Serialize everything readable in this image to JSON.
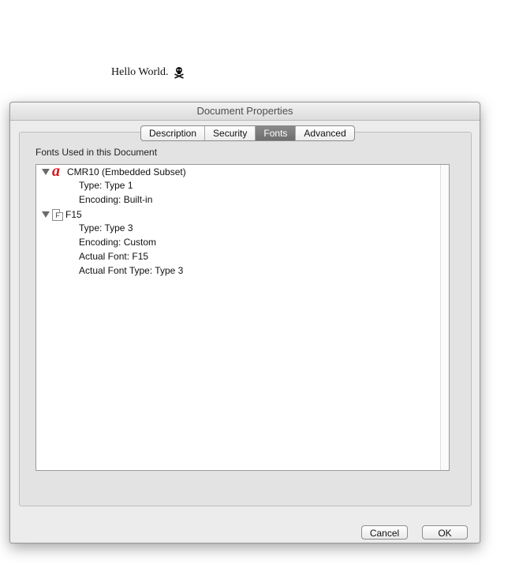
{
  "document": {
    "text": "Hello World."
  },
  "dialog": {
    "title": "Document Properties",
    "tabs": [
      {
        "label": "Description",
        "active": false
      },
      {
        "label": "Security",
        "active": false
      },
      {
        "label": "Fonts",
        "active": true
      },
      {
        "label": "Advanced",
        "active": false
      }
    ],
    "group_label": "Fonts Used in this Document",
    "fonts": [
      {
        "name": "CMR10 (Embedded Subset)",
        "icon": "acrobat-font-icon",
        "details": [
          "Type: Type 1",
          "Encoding: Built-in"
        ]
      },
      {
        "name": "F15",
        "icon": "generic-font-file-icon",
        "details": [
          "Type: Type 3",
          "Encoding: Custom",
          "Actual Font: F15",
          "Actual Font Type: Type 3"
        ]
      }
    ],
    "buttons": {
      "cancel": "Cancel",
      "ok": "OK"
    }
  },
  "colors": {
    "active_tab": "#7a7a7a",
    "font_icon_red": "#d7181e"
  }
}
